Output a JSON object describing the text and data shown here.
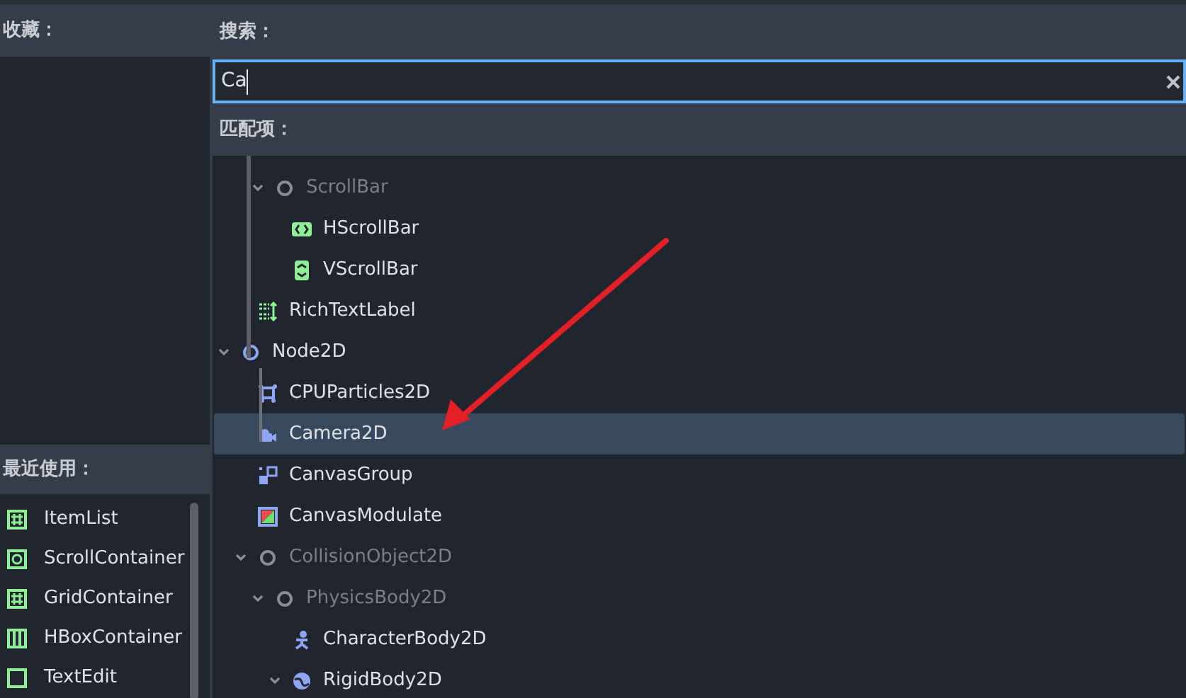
{
  "favorites": {
    "title": "收藏："
  },
  "recent": {
    "title": "最近使用：",
    "items": [
      {
        "label": "ItemList",
        "kind": "grid"
      },
      {
        "label": "ScrollContainer",
        "kind": "scroll"
      },
      {
        "label": "GridContainer",
        "kind": "grid"
      },
      {
        "label": "HBoxContainer",
        "kind": "hbox"
      },
      {
        "label": "TextEdit",
        "kind": "textedit"
      }
    ]
  },
  "search": {
    "title": "搜索：",
    "value": "Ca"
  },
  "matches": {
    "title": "匹配项：",
    "tree": [
      {
        "children": [
          {
            "children": [
              {
                "label": "ScrollBar",
                "kind": "circle",
                "expanded": true,
                "disabled": true,
                "selected": false,
                "children": [
                  {
                    "label": "HScrollBar",
                    "kind": "hscroll",
                    "disabled": false,
                    "selected": false
                  },
                  {
                    "label": "VScrollBar",
                    "kind": "vscroll",
                    "disabled": false,
                    "selected": false
                  }
                ]
              }
            ]
          },
          {
            "label": "RichTextLabel",
            "kind": "richtext",
            "disabled": false,
            "selected": false
          }
        ]
      },
      {
        "label": "Node2D",
        "kind": "circle2d",
        "expanded": true,
        "disabled": false,
        "selected": false,
        "children": [
          {
            "label": "CPUParticles2D",
            "kind": "particles",
            "disabled": false,
            "selected": false
          },
          {
            "label": "Camera2D",
            "kind": "camera",
            "disabled": false,
            "selected": true
          },
          {
            "label": "CanvasGroup",
            "kind": "canvasgroup",
            "disabled": false,
            "selected": false
          },
          {
            "label": "CanvasModulate",
            "kind": "modulate",
            "disabled": false,
            "selected": false
          },
          {
            "label": "CollisionObject2D",
            "kind": "circle",
            "expanded": true,
            "disabled": true,
            "selected": false,
            "children": [
              {
                "label": "PhysicsBody2D",
                "kind": "circle",
                "expanded": true,
                "disabled": true,
                "selected": false,
                "children": [
                  {
                    "label": "CharacterBody2D",
                    "kind": "character",
                    "disabled": false,
                    "selected": false
                  },
                  {
                    "label": "RigidBody2D",
                    "kind": "globe",
                    "expanded": true,
                    "disabled": false,
                    "selected": false
                  }
                ]
              }
            ]
          }
        ]
      }
    ]
  }
}
